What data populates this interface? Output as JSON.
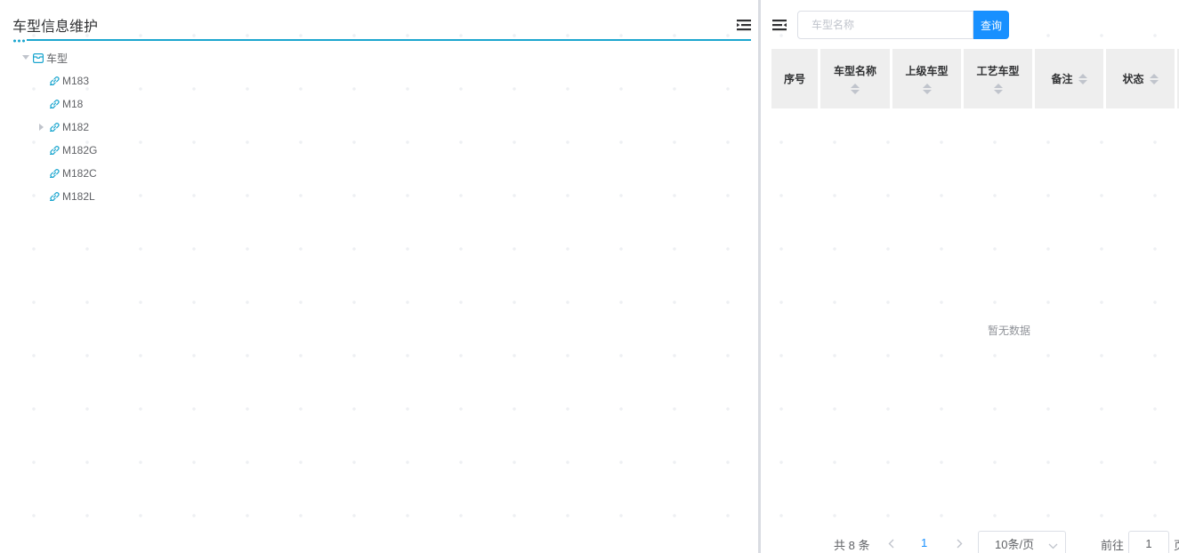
{
  "left_panel": {
    "title": "车型信息维护",
    "tree": {
      "root": {
        "label": "车型",
        "expanded": true,
        "icon": "folder-icon"
      },
      "children": [
        {
          "label": "M183",
          "has_children": false,
          "icon": "link-icon"
        },
        {
          "label": "M18",
          "has_children": false,
          "icon": "link-icon"
        },
        {
          "label": "M182",
          "has_children": true,
          "icon": "link-icon"
        },
        {
          "label": "M182G",
          "has_children": false,
          "icon": "link-icon"
        },
        {
          "label": "M182C",
          "has_children": false,
          "icon": "link-icon"
        },
        {
          "label": "M182L",
          "has_children": false,
          "icon": "link-icon"
        }
      ]
    }
  },
  "right_panel": {
    "search": {
      "placeholder": "车型名称",
      "value": "",
      "button_label": "查询"
    },
    "table": {
      "columns": [
        {
          "label": "序号",
          "sortable": false
        },
        {
          "label": "车型名称",
          "sortable": true
        },
        {
          "label": "上级车型",
          "sortable": true
        },
        {
          "label": "工艺车型",
          "sortable": true
        },
        {
          "label": "备注",
          "sortable": true
        },
        {
          "label": "状态",
          "sortable": true
        }
      ],
      "empty_text": "暂无数据"
    },
    "pagination": {
      "total_text": "共 8 条",
      "current_page": "1",
      "page_size": "10条/页",
      "goto_label": "前往",
      "goto_value": "1",
      "goto_unit": "页"
    }
  },
  "colors": {
    "accent": "#1ba6cf",
    "primary": "#1890ff",
    "header_bg": "#eeeeee"
  }
}
